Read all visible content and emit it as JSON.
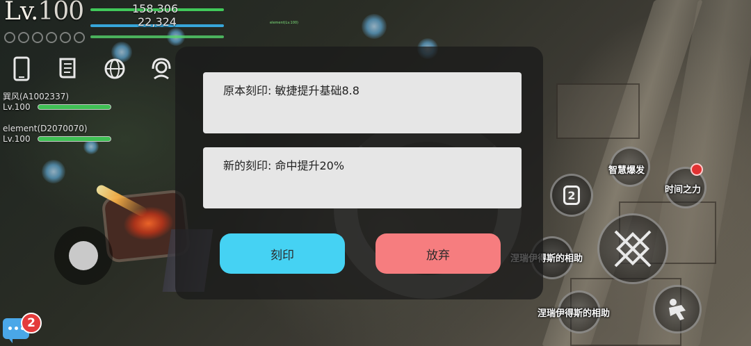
{
  "hud": {
    "level_prefix": "Lv.",
    "level_value": "100",
    "hp_text": "158,306",
    "mp_text": "22,324",
    "overhead_name": "element(Lv.100)"
  },
  "menu_icons": [
    "phone-icon",
    "scroll-icon",
    "globe-icon",
    "headset-icon"
  ],
  "party": [
    {
      "name": "巽风(A1002337)",
      "level": "Lv.100"
    },
    {
      "name": "element(D2070070)",
      "level": "Lv.100"
    }
  ],
  "dialog": {
    "original_rune": "原本刻印: 敏捷提升基础8.8",
    "new_rune": "新的刻印: 命中提升20%",
    "engrave_label": "刻印",
    "discard_label": "放弃"
  },
  "skills": {
    "wisdom_burst": "智慧爆发",
    "time_power": "时间之力",
    "slot_number": "2",
    "blessing_1": "涅瑞伊得斯的相助",
    "blessing_2": "涅瑞伊得斯的相助"
  },
  "chat": {
    "unread_count": "2"
  },
  "colors": {
    "engrave_button": "#45d2f3",
    "discard_button": "#f67d7f",
    "hp_bar": "#41c95a",
    "mp_bar": "#37a6d9",
    "badge": "#e43b3b"
  }
}
